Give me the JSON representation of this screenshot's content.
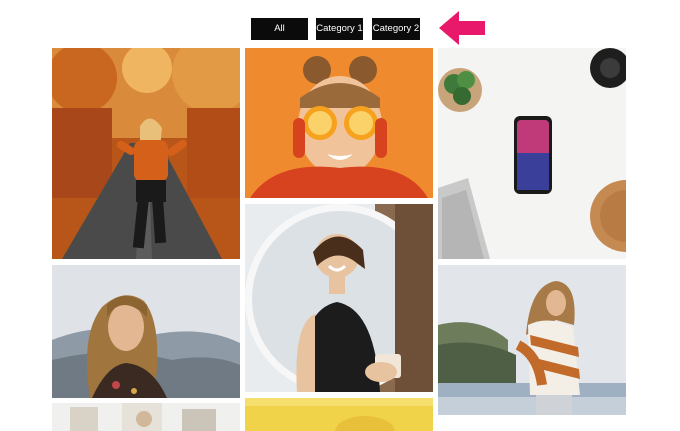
{
  "filters": [
    {
      "label": "All categories"
    },
    {
      "label": "Category 1"
    },
    {
      "label": "Category 2"
    }
  ],
  "annotation": {
    "arrow_color": "#e8196a"
  },
  "gallery": {
    "items": [
      {
        "subject": "woman in orange sweater walking on autumn forest road"
      },
      {
        "subject": "girl holding orange halves over her eyes"
      },
      {
        "subject": "smartphone on white desk with plant and cork coaster"
      },
      {
        "subject": "smiling woman with coffee mug by round mirror"
      },
      {
        "subject": "woman with long hair, mountain landscape background"
      },
      {
        "subject": "woman in striped sweater by the sea"
      },
      {
        "subject": "bright interior scene"
      },
      {
        "subject": "yellow background scene"
      }
    ]
  }
}
